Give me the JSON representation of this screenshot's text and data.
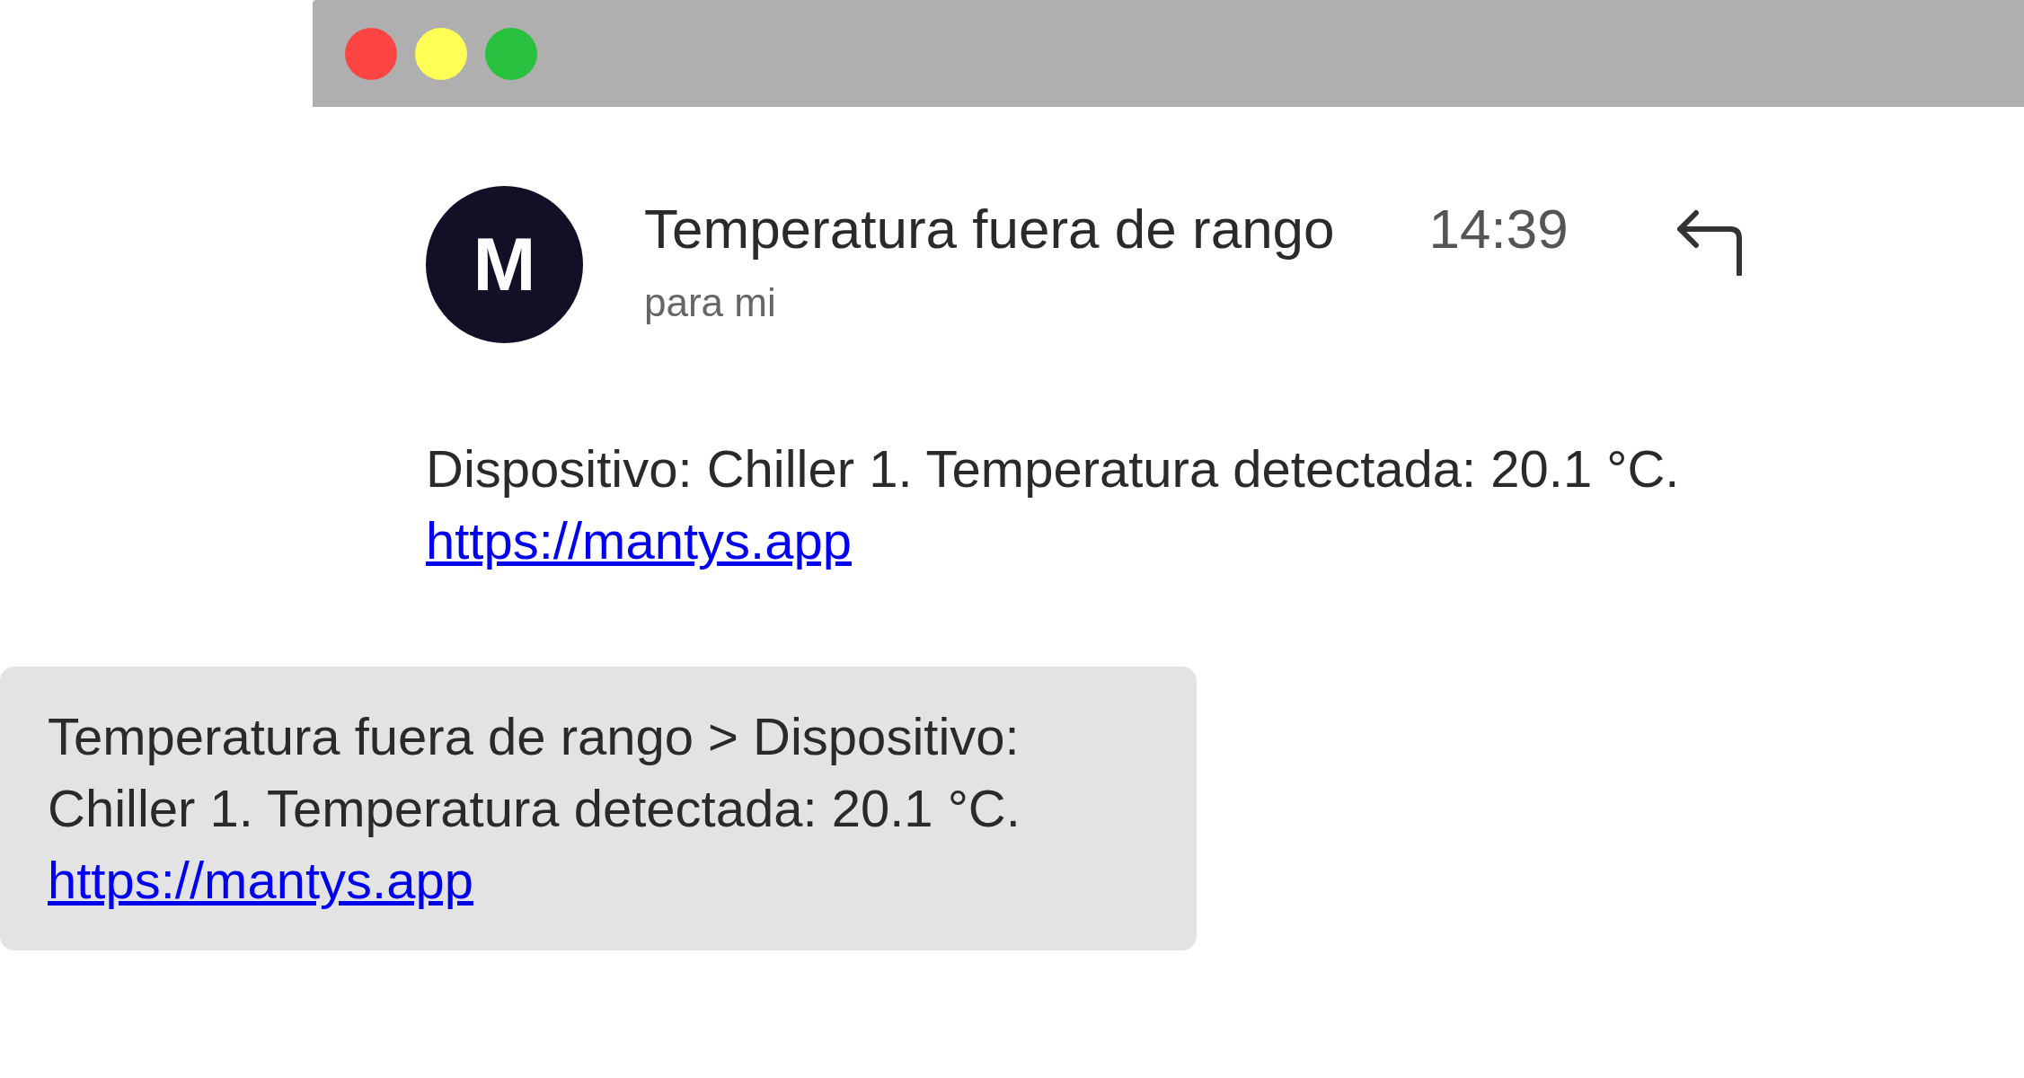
{
  "window": {
    "controls": [
      {
        "color": "#ff4444"
      },
      {
        "color": "#ffff55"
      },
      {
        "color": "#2bc140"
      }
    ]
  },
  "email": {
    "avatar_initial": "M",
    "subject": "Temperatura fuera de rango",
    "time": "14:39",
    "recipient": "para mi",
    "body": "Dispositivo: Chiller 1. Temperatura detectada: 20.1 °C.",
    "link": "https://mantys.app"
  },
  "notification": {
    "text": "Temperatura fuera de rango > Dispositivo: Chiller 1. Temperatura detectada: 20.1 °C.",
    "link": "https://mantys.app"
  }
}
